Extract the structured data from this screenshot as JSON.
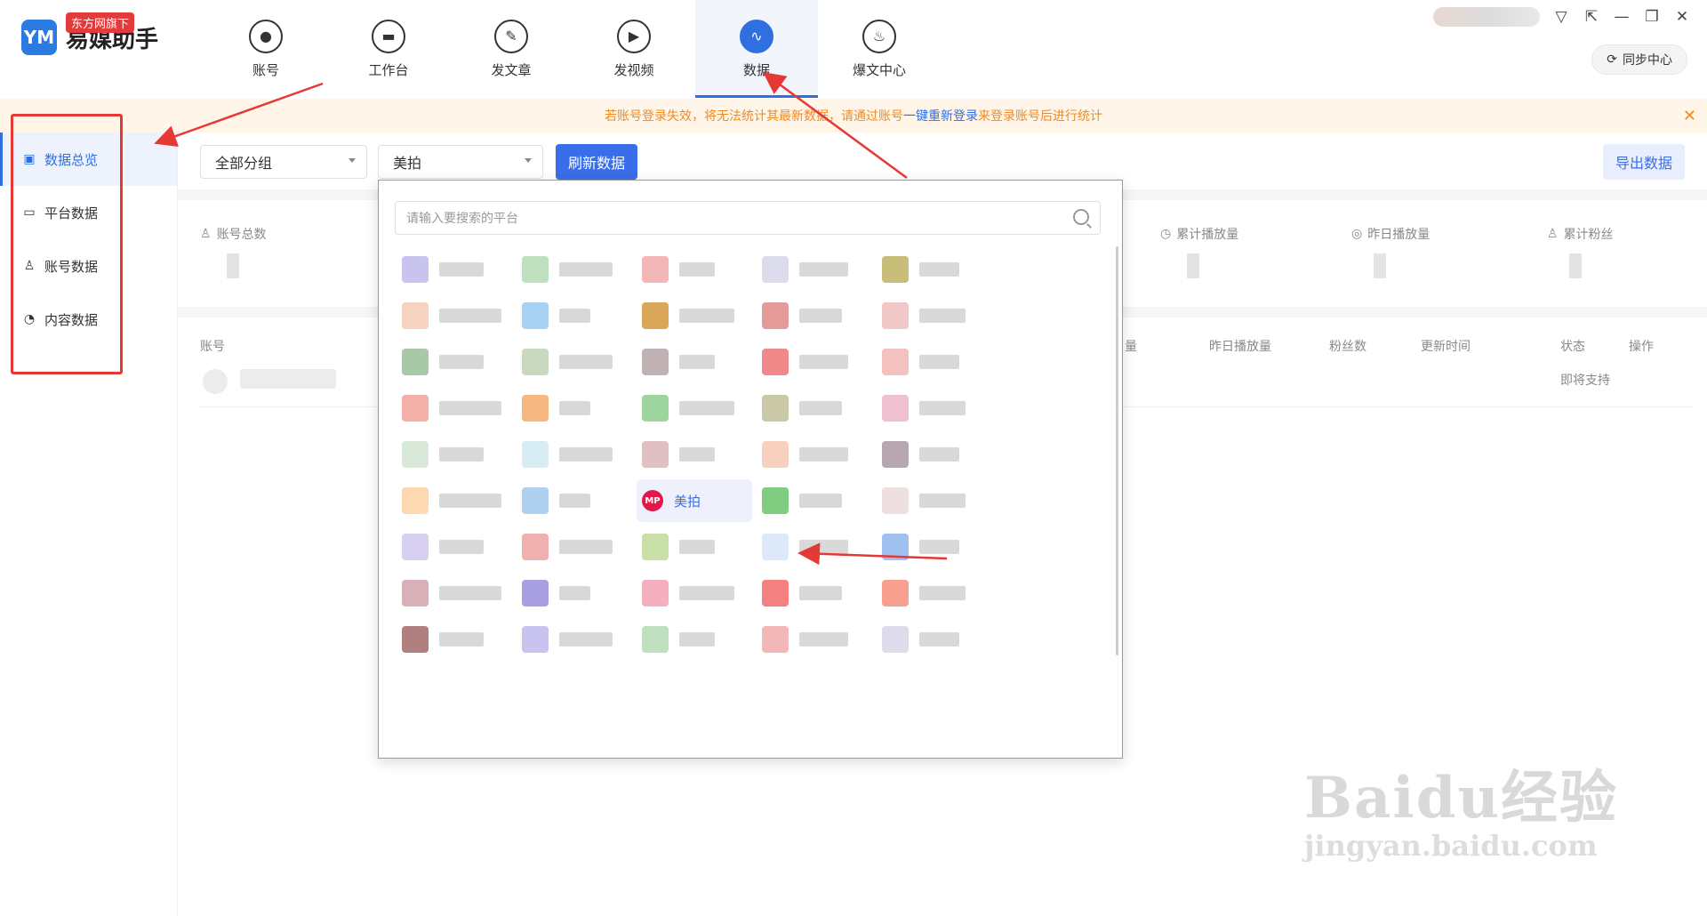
{
  "app": {
    "logo_mark": "YM",
    "logo_text": "易媒助手",
    "logo_badge": "东方网旗下"
  },
  "nav": [
    {
      "label": "账号",
      "icon": "user-icon"
    },
    {
      "label": "工作台",
      "icon": "monitor-icon"
    },
    {
      "label": "发文章",
      "icon": "feather-icon"
    },
    {
      "label": "发视频",
      "icon": "play-icon"
    },
    {
      "label": "数据",
      "icon": "chart-icon",
      "active": true
    },
    {
      "label": "爆文中心",
      "icon": "fire-icon"
    }
  ],
  "window": {
    "sync_label": "同步中心"
  },
  "notice": {
    "text_before": "若账号登录失效，将无法统计其最新数据，请通过账号",
    "link": "一键重新登录",
    "text_after": "来登录账号后进行统计"
  },
  "sidebar": {
    "items": [
      {
        "label": "数据总览",
        "icon": "chart-icon",
        "active": true
      },
      {
        "label": "平台数据",
        "icon": "monitor-icon"
      },
      {
        "label": "账号数据",
        "icon": "user-icon"
      },
      {
        "label": "内容数据",
        "icon": "pie-icon"
      }
    ]
  },
  "toolbar": {
    "group_select": "全部分组",
    "platform_select": "美拍",
    "refresh_label": "刷新数据",
    "export_label": "导出数据"
  },
  "stats": [
    {
      "label": "账号总数"
    },
    {
      "label": "累计播放量"
    },
    {
      "label": "昨日播放量"
    },
    {
      "label": "累计粉丝"
    }
  ],
  "table": {
    "headers": [
      "账号",
      "量",
      "昨日播放量",
      "粉丝数",
      "更新时间",
      "状态",
      "操作"
    ],
    "row_status": "即将支持"
  },
  "dropdown": {
    "placeholder": "请输入要搜索的平台",
    "selected_label": "美拍",
    "selected_icon_text": "MP"
  },
  "watermark": {
    "brand": "Baidu经验",
    "url": "jingyan.baidu.com"
  },
  "colors": {
    "accent": "#3a6ee8",
    "notice_bg": "#fff5e8",
    "notice_text": "#f08b22",
    "annotation_red": "#e53935"
  }
}
